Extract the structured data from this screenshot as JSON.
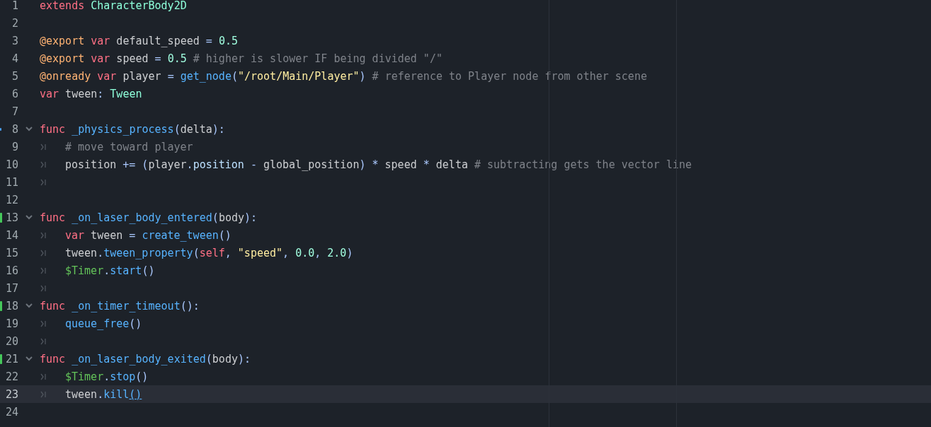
{
  "editor": {
    "lines": [
      {
        "number": "1",
        "foldable": false,
        "indented": false,
        "current": false,
        "changed": false,
        "marked": false,
        "tokens": [
          {
            "text": "extends ",
            "kind": "keyword"
          },
          {
            "text": "CharacterBody2D",
            "kind": "type"
          }
        ]
      },
      {
        "number": "2",
        "foldable": false,
        "indented": false,
        "current": false,
        "changed": false,
        "marked": false
      },
      {
        "number": "3",
        "foldable": false,
        "indented": false,
        "current": false,
        "changed": false,
        "marked": false,
        "tokens": [
          {
            "text": "@export ",
            "kind": "annotation"
          },
          {
            "text": "var",
            "kind": "keyword"
          },
          {
            "text": " default_speed ",
            "kind": "text"
          },
          {
            "text": "= ",
            "kind": "symbol"
          },
          {
            "text": "0.5",
            "kind": "number"
          }
        ]
      },
      {
        "number": "4",
        "foldable": false,
        "indented": false,
        "current": false,
        "changed": false,
        "marked": false,
        "tokens": [
          {
            "text": "@export ",
            "kind": "annotation"
          },
          {
            "text": "var",
            "kind": "keyword"
          },
          {
            "text": " speed ",
            "kind": "text"
          },
          {
            "text": "= ",
            "kind": "symbol"
          },
          {
            "text": "0.5",
            "kind": "number"
          },
          {
            "text": " # higher is slower IF being divided \"/\"",
            "kind": "comment"
          }
        ]
      },
      {
        "number": "5",
        "foldable": false,
        "indented": false,
        "current": false,
        "changed": false,
        "marked": false,
        "tokens": [
          {
            "text": "@onready ",
            "kind": "annotation"
          },
          {
            "text": "var",
            "kind": "keyword"
          },
          {
            "text": " player ",
            "kind": "text"
          },
          {
            "text": "= ",
            "kind": "symbol"
          },
          {
            "text": "get_node",
            "kind": "call"
          },
          {
            "text": "(",
            "kind": "symbol"
          },
          {
            "text": "\"/root/Main/Player\"",
            "kind": "string"
          },
          {
            "text": ")",
            "kind": "symbol"
          },
          {
            "text": " # reference to Player node from other scene",
            "kind": "comment"
          }
        ]
      },
      {
        "number": "6",
        "foldable": false,
        "indented": false,
        "current": false,
        "changed": false,
        "marked": false,
        "tokens": [
          {
            "text": "var",
            "kind": "keyword"
          },
          {
            "text": " tween",
            "kind": "text"
          },
          {
            "text": ": ",
            "kind": "symbol"
          },
          {
            "text": "Tween",
            "kind": "type"
          }
        ]
      },
      {
        "number": "7",
        "foldable": false,
        "indented": false,
        "current": false,
        "changed": false,
        "marked": false
      },
      {
        "number": "8",
        "foldable": true,
        "indented": false,
        "current": false,
        "changed": false,
        "marked": true,
        "tokens": [
          {
            "text": "func ",
            "kind": "keyword"
          },
          {
            "text": "_physics_process",
            "kind": "call"
          },
          {
            "text": "(",
            "kind": "symbol"
          },
          {
            "text": "delta",
            "kind": "text"
          },
          {
            "text": "):",
            "kind": "symbol"
          }
        ]
      },
      {
        "number": "9",
        "foldable": false,
        "indented": true,
        "current": false,
        "changed": false,
        "marked": false,
        "tokens": [
          {
            "text": "# move toward player",
            "kind": "comment"
          }
        ]
      },
      {
        "number": "10",
        "foldable": false,
        "indented": true,
        "current": false,
        "changed": false,
        "marked": false,
        "tokens": [
          {
            "text": "position ",
            "kind": "text"
          },
          {
            "text": "+= (",
            "kind": "symbol"
          },
          {
            "text": "player",
            "kind": "text"
          },
          {
            "text": ".",
            "kind": "symbol"
          },
          {
            "text": "position ",
            "kind": "member"
          },
          {
            "text": "-",
            "kind": "symbol"
          },
          {
            "text": " global_position",
            "kind": "text"
          },
          {
            "text": ") * ",
            "kind": "symbol"
          },
          {
            "text": "speed ",
            "kind": "text"
          },
          {
            "text": "*",
            "kind": "symbol"
          },
          {
            "text": " delta",
            "kind": "text"
          },
          {
            "text": " # subtracting gets the vector line",
            "kind": "comment"
          }
        ]
      },
      {
        "number": "11",
        "foldable": false,
        "indented": true,
        "current": false,
        "changed": false,
        "marked": false
      },
      {
        "number": "12",
        "foldable": false,
        "indented": false,
        "current": false,
        "changed": false,
        "marked": false
      },
      {
        "number": "13",
        "foldable": true,
        "indented": false,
        "current": false,
        "changed": true,
        "marked": false,
        "tokens": [
          {
            "text": "func ",
            "kind": "keyword"
          },
          {
            "text": "_on_laser_body_entered",
            "kind": "call"
          },
          {
            "text": "(",
            "kind": "symbol"
          },
          {
            "text": "body",
            "kind": "text"
          },
          {
            "text": "):",
            "kind": "symbol"
          }
        ]
      },
      {
        "number": "14",
        "foldable": false,
        "indented": true,
        "current": false,
        "changed": false,
        "marked": false,
        "tokens": [
          {
            "text": "var",
            "kind": "keyword"
          },
          {
            "text": " tween ",
            "kind": "text"
          },
          {
            "text": "= ",
            "kind": "symbol"
          },
          {
            "text": "create_tween",
            "kind": "call"
          },
          {
            "text": "()",
            "kind": "symbol"
          }
        ]
      },
      {
        "number": "15",
        "foldable": false,
        "indented": true,
        "current": false,
        "changed": false,
        "marked": false,
        "tokens": [
          {
            "text": "tween",
            "kind": "text"
          },
          {
            "text": ".",
            "kind": "symbol"
          },
          {
            "text": "tween_property",
            "kind": "call"
          },
          {
            "text": "(",
            "kind": "symbol"
          },
          {
            "text": "self",
            "kind": "keyword"
          },
          {
            "text": ", ",
            "kind": "symbol"
          },
          {
            "text": "\"speed\"",
            "kind": "string"
          },
          {
            "text": ", ",
            "kind": "symbol"
          },
          {
            "text": "0.0",
            "kind": "number"
          },
          {
            "text": ", ",
            "kind": "symbol"
          },
          {
            "text": "2.0",
            "kind": "number"
          },
          {
            "text": ")",
            "kind": "symbol"
          }
        ]
      },
      {
        "number": "16",
        "foldable": false,
        "indented": true,
        "current": false,
        "changed": false,
        "marked": false,
        "tokens": [
          {
            "text": "$Timer",
            "kind": "node"
          },
          {
            "text": ".",
            "kind": "symbol"
          },
          {
            "text": "start",
            "kind": "call"
          },
          {
            "text": "()",
            "kind": "symbol"
          }
        ]
      },
      {
        "number": "17",
        "foldable": false,
        "indented": true,
        "current": false,
        "changed": false,
        "marked": false
      },
      {
        "number": "18",
        "foldable": true,
        "indented": false,
        "current": false,
        "changed": true,
        "marked": false,
        "tokens": [
          {
            "text": "func ",
            "kind": "keyword"
          },
          {
            "text": "_on_timer_timeout",
            "kind": "call"
          },
          {
            "text": "():",
            "kind": "symbol"
          }
        ]
      },
      {
        "number": "19",
        "foldable": false,
        "indented": true,
        "current": false,
        "changed": false,
        "marked": false,
        "tokens": [
          {
            "text": "queue_free",
            "kind": "call"
          },
          {
            "text": "()",
            "kind": "symbol"
          }
        ]
      },
      {
        "number": "20",
        "foldable": false,
        "indented": true,
        "current": false,
        "changed": false,
        "marked": false
      },
      {
        "number": "21",
        "foldable": true,
        "indented": false,
        "current": false,
        "changed": true,
        "marked": false,
        "tokens": [
          {
            "text": "func ",
            "kind": "keyword"
          },
          {
            "text": "_on_laser_body_exited",
            "kind": "call"
          },
          {
            "text": "(",
            "kind": "symbol"
          },
          {
            "text": "body",
            "kind": "text"
          },
          {
            "text": "):",
            "kind": "symbol"
          }
        ]
      },
      {
        "number": "22",
        "foldable": false,
        "indented": true,
        "current": false,
        "changed": false,
        "marked": false,
        "tokens": [
          {
            "text": "$Timer",
            "kind": "node"
          },
          {
            "text": ".",
            "kind": "symbol"
          },
          {
            "text": "stop",
            "kind": "call"
          },
          {
            "text": "()",
            "kind": "symbol"
          }
        ]
      },
      {
        "number": "23",
        "foldable": false,
        "indented": true,
        "current": true,
        "changed": false,
        "marked": false,
        "tokens": [
          {
            "text": "tween",
            "kind": "text"
          },
          {
            "text": ".",
            "kind": "symbol"
          },
          {
            "text": "kill",
            "kind": "call"
          },
          {
            "text": "()",
            "kind": "matched"
          }
        ]
      },
      {
        "number": "24",
        "foldable": false,
        "indented": false,
        "current": false,
        "changed": false,
        "marked": false
      }
    ]
  }
}
